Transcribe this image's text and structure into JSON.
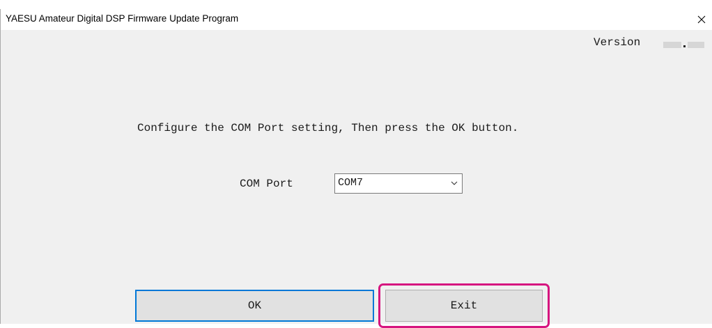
{
  "window": {
    "title": "YAESU Amateur Digital DSP Firmware Update Program",
    "close_symbol": "×"
  },
  "version": {
    "label": "Version",
    "separator": "."
  },
  "instruction": "Configure the COM Port setting, Then press the OK button.",
  "com_port": {
    "label": "COM Port",
    "selected": "COM7"
  },
  "buttons": {
    "ok": "OK",
    "exit": "Exit"
  },
  "colors": {
    "highlight": "#d6157f",
    "focus_border": "#0078d7",
    "button_face": "#e1e1e1",
    "dialog_background": "#f0f0f0"
  },
  "icons": {
    "close": "close-icon",
    "dropdown": "chevron-down-icon"
  }
}
